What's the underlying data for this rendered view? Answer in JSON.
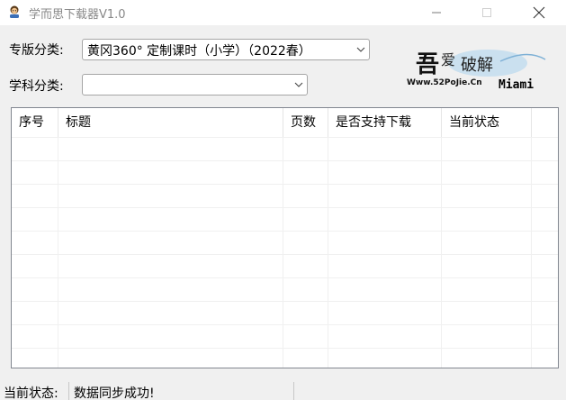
{
  "window": {
    "title": "学而思下载器V1.0",
    "controls": {
      "minimize_icon": "minimize-icon",
      "maximize_icon": "maximize-icon",
      "close_icon": "close-icon"
    }
  },
  "form": {
    "edition_label": "专版分类:",
    "edition_value": "黄冈360° 定制课时（小学）（2022春）",
    "subject_label": "学科分类:",
    "subject_value": ""
  },
  "logo": {
    "main": "吾爱破解",
    "url": "Www.52PoJie.Cn",
    "signature": "Miami"
  },
  "table": {
    "columns": [
      "序号",
      "标题",
      "页数",
      "是否支持下载",
      "当前状态"
    ],
    "rows": []
  },
  "status": {
    "label": "当前状态:",
    "value": "数据同步成功!"
  },
  "colors": {
    "border": "#a6a6a6",
    "list_border": "#828790",
    "background": "#f0f0f0"
  }
}
